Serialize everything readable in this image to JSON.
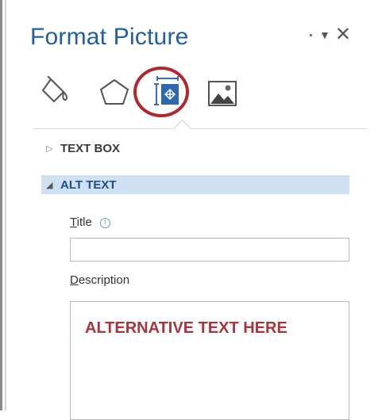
{
  "pane": {
    "title": "Format Picture"
  },
  "tabs": [
    {
      "name": "fill-line",
      "icon": "paint-bucket-icon",
      "active": false
    },
    {
      "name": "effects",
      "icon": "pentagon-icon",
      "active": false
    },
    {
      "name": "size-properties",
      "icon": "layout-properties-icon",
      "active": true
    },
    {
      "name": "picture",
      "icon": "picture-icon",
      "active": false
    }
  ],
  "sections": {
    "text_box": {
      "label": "TEXT BOX",
      "expanded": false
    },
    "alt_text": {
      "label": "ALT TEXT",
      "expanded": true,
      "title_label_accel": "T",
      "title_label_rest": "itle",
      "title_value": "",
      "description_label_accel": "D",
      "description_label_rest": "escription",
      "description_value": "ALTERNATIVE TEXT HERE"
    }
  },
  "colors": {
    "title": "#1f5fa7",
    "section_selected_bg": "#cfe0f3",
    "highlight_circle": "#b0272e",
    "description_text": "#a7353d"
  }
}
